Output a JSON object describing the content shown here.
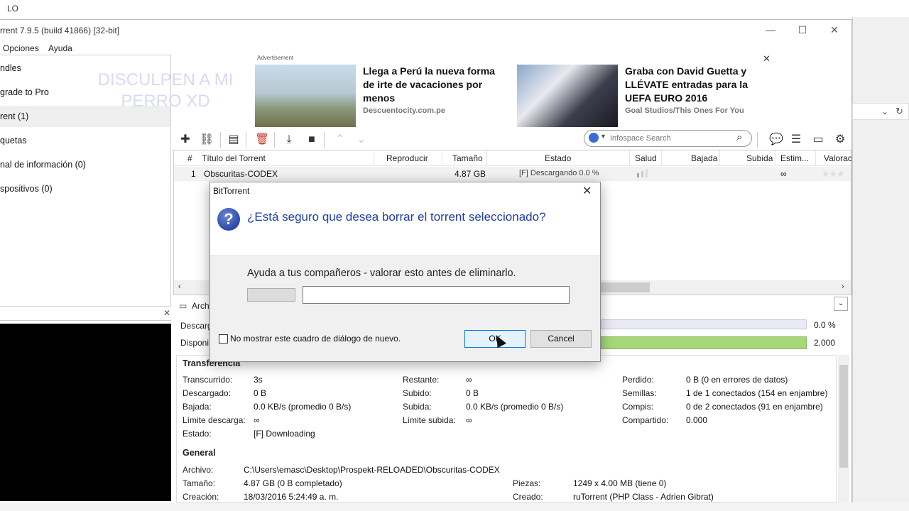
{
  "top_strip": {
    "tab_label": "LO"
  },
  "window": {
    "title": "rrent 7.9.5  (build 41866) [32-bit]",
    "menu": [
      "Opciones",
      "Ayuda"
    ]
  },
  "sidebar": {
    "items": [
      {
        "label": "ndles"
      },
      {
        "label": "grade to Pro"
      },
      {
        "label": "rent (1)"
      },
      {
        "label": "quetas"
      },
      {
        "label": "nal de información (0)"
      },
      {
        "label": "spositivos (0)"
      }
    ],
    "watermark": "DISCULPEN A MI PERRO XD"
  },
  "ads": {
    "label": "Advertisement",
    "ad1": {
      "title": "Llega a Perú la nueva forma de irte de vacaciones por menos",
      "source": "Descuentocity.com.pe"
    },
    "ad2": {
      "title": "Graba con David Guetta y LLÉVATE entradas para la UEFA EURO 2016",
      "source": "Goal Studios/This Ones For You"
    }
  },
  "toolbar": {
    "search_placeholder": "Infospace Search"
  },
  "list": {
    "columns": [
      "#",
      "Título del Torrent",
      "Reproducir",
      "Tamaño",
      "Estado",
      "Salud",
      "Bajada",
      "Subida",
      "Estim...",
      "Valorac"
    ],
    "rows": [
      {
        "num": "1",
        "title": "Obscuritas-CODEX",
        "size": "4.87 GB",
        "status": "[F] Descargando 0.0 %",
        "eta": "∞"
      }
    ]
  },
  "details": {
    "tab_label": "Arch",
    "downloaded_label": "Descarg",
    "available_label": "Disponi",
    "downloaded_pct": "0.0 %",
    "availability": "2.000",
    "transfer": {
      "header": "Transferencia",
      "elapsed_label": "Transcurrido:",
      "elapsed": "3s",
      "downloaded_label": "Descargado:",
      "downloaded": "0 B",
      "down_speed_label": "Bajada:",
      "down_speed": "0.0 KB/s (promedio 0 B/s)",
      "down_limit_label": "Límite descarga:",
      "down_limit": "∞",
      "state_label": "Estado:",
      "state": "[F] Downloading",
      "remaining_label": "Restante:",
      "remaining": "∞",
      "uploaded_label": "Subido:",
      "uploaded": "0 B",
      "up_speed_label": "Subida:",
      "up_speed": "0.0 KB/s (promedio 0 B/s)",
      "up_limit_label": "Límite subida:",
      "up_limit": "∞",
      "lost_label": "Perdido:",
      "lost": "0 B (0 en errores de datos)",
      "seeds_label": "Semillas:",
      "seeds": "1 de 1 conectados (154 en enjambre)",
      "peers_label": "Compis:",
      "peers": "0 de 2 conectados (91 en enjambre)",
      "shared_label": "Compartido:",
      "shared": "0.000"
    },
    "general": {
      "header": "General",
      "file_label": "Archivo:",
      "file": "C:\\Users\\emasc\\Desktop\\Prospekt-RELOADED\\Obscuritas-CODEX",
      "size_label": "Tamaño:",
      "size": "4.87 GB (0 B completado)",
      "created_label": "Creación:",
      "created": "18/03/2016 5:24:49 a. m.",
      "pieces_label": "Piezas:",
      "pieces": "1249 x 4.00 MB (tiene 0)",
      "created_by_label": "Creado:",
      "created_by": "ruTorrent (PHP Class - Adrien Gibrat)"
    }
  },
  "dialog": {
    "title": "BitTorrent",
    "question": "¿Está seguro que desea borrar el torrent seleccionado?",
    "rate_label": "Ayuda a tus compañeros - valorar esto antes de eliminarlo.",
    "checkbox_label": "No mostrar este cuadro de diálogo de nuevo.",
    "ok_label": "OK",
    "cancel_label": "Cancel",
    "icon": "question-icon"
  },
  "colors": {
    "question_text": "#1f3ea1",
    "availability_bar": "#a6d87a",
    "ok_border": "#0078d7"
  }
}
